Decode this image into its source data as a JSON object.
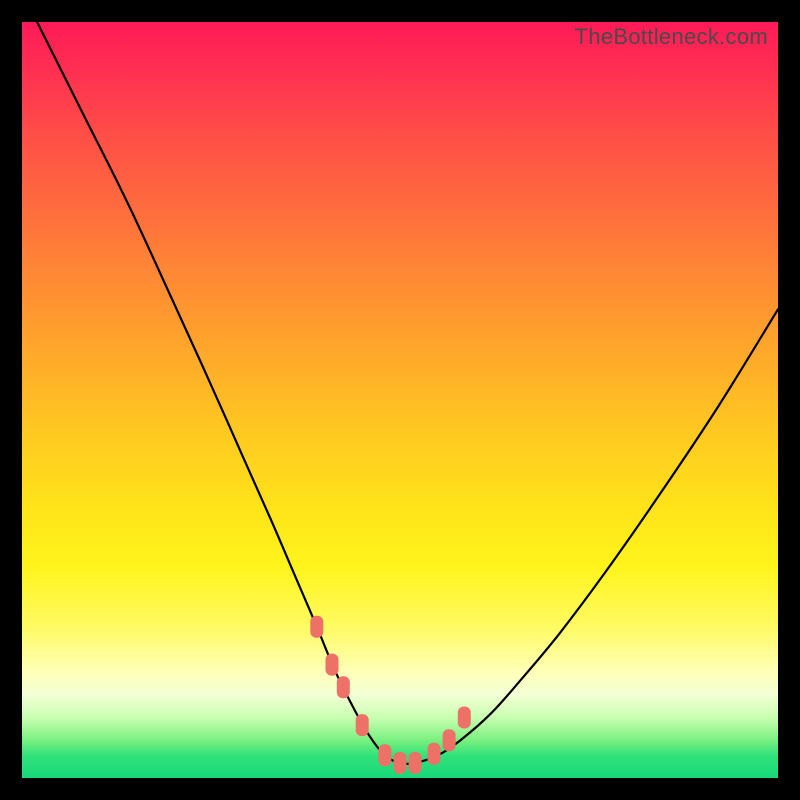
{
  "watermark": "TheBottleneck.com",
  "colors": {
    "frame": "#000000",
    "curve": "#000000",
    "markers": "#ed7167",
    "gradient_top": "#ff1a57",
    "gradient_mid": "#ffe31a",
    "gradient_bottom": "#16d97a"
  },
  "chart_data": {
    "type": "line",
    "title": "",
    "xlabel": "",
    "ylabel": "",
    "xlim": [
      0,
      100
    ],
    "ylim": [
      0,
      100
    ],
    "grid": false,
    "legend_position": "none",
    "annotations": [
      "TheBottleneck.com"
    ],
    "series": [
      {
        "name": "bottleneck-curve",
        "x": [
          2,
          8,
          14,
          20,
          25,
          29,
          33,
          36,
          39,
          41.5,
          44,
          46,
          48,
          50,
          52,
          55,
          58,
          62,
          66,
          71,
          77,
          84,
          92,
          100
        ],
        "y": [
          100,
          88,
          76,
          63,
          52,
          43,
          34,
          27,
          20,
          14,
          9,
          5.5,
          3,
          2,
          2,
          3,
          5,
          8.5,
          13,
          19,
          27,
          37,
          49,
          62
        ]
      }
    ],
    "markers": {
      "name": "highlight-points",
      "x": [
        39,
        41,
        42.5,
        45,
        48,
        50,
        52,
        54.5,
        56.5,
        58.5
      ],
      "y": [
        20,
        15,
        12,
        7,
        3,
        2,
        2,
        3.2,
        5,
        8
      ]
    }
  }
}
